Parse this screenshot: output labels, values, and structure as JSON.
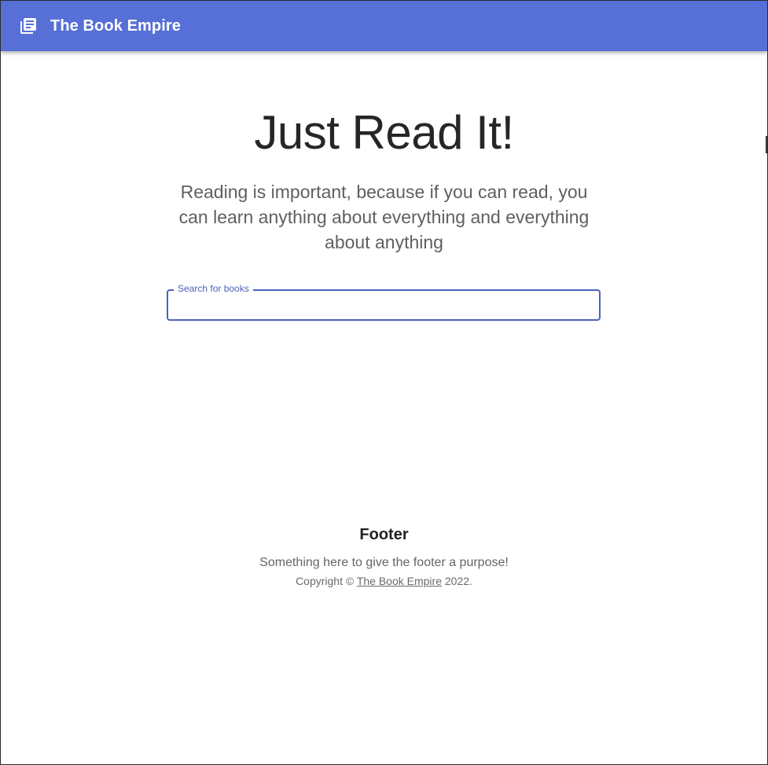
{
  "appbar": {
    "icon": "library-books-icon",
    "title": "The Book Empire",
    "background": "#5670d8"
  },
  "hero": {
    "title": "Just Read It!",
    "subtitle": "Reading is important, because if you can read, you can learn anything about everything and everything about anything"
  },
  "search": {
    "label": "Search for books",
    "value": "",
    "accent": "#4c62bd"
  },
  "footer": {
    "heading": "Footer",
    "text": "Something here to give the footer a purpose!",
    "copyright_prefix": "Copyright © ",
    "copyright_link": "The Book Empire",
    "copyright_suffix": " 2022."
  }
}
